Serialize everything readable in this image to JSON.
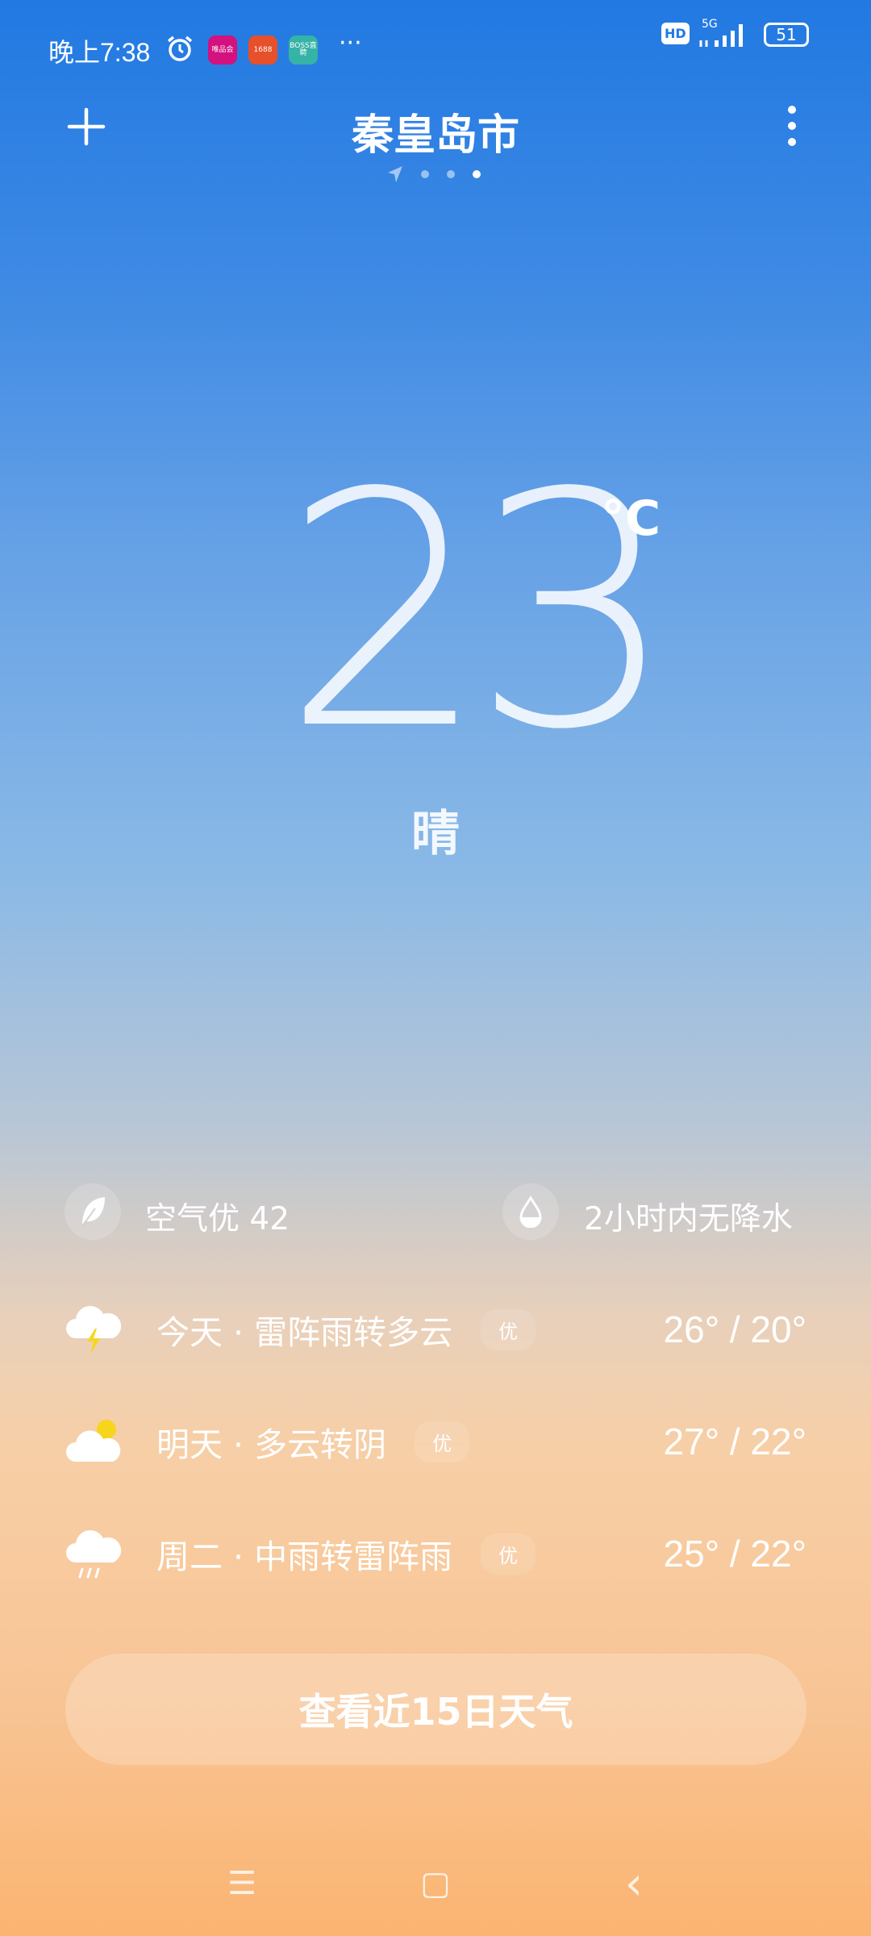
{
  "status_bar": {
    "time": "晚上7:38",
    "apps": [
      "唯品会",
      "1688",
      "BOSS直聘"
    ],
    "more": "···",
    "hd": "HD",
    "network": "5G",
    "battery": "51"
  },
  "header": {
    "city": "秦皇岛市",
    "add_icon": "plus-icon",
    "menu_icon": "more-vertical-icon",
    "page_count": 4,
    "active_page": 4
  },
  "current": {
    "temperature": "23",
    "unit": "°C",
    "condition": "晴"
  },
  "info": {
    "air": "空气优 42",
    "precip": "2小时内无降水"
  },
  "forecast": [
    {
      "icon": "thunderstorm-icon",
      "label": "今天 · 雷阵雨转多云",
      "aqi": "优",
      "temps": "26° / 20°"
    },
    {
      "icon": "partly-cloudy-icon",
      "label": "明天 · 多云转阴",
      "aqi": "优",
      "temps": "27° / 22°"
    },
    {
      "icon": "rain-icon",
      "label": "周二 · 中雨转雷阵雨",
      "aqi": "优",
      "temps": "25° / 22°"
    }
  ],
  "button": {
    "label": "查看近15日天气"
  },
  "nav": {
    "menu": "☰",
    "home": "▢",
    "back": "‹"
  },
  "colors": {
    "sky_top": "#2179e2",
    "sky_bottom": "#fbb471",
    "sun": "#f7d51d"
  }
}
